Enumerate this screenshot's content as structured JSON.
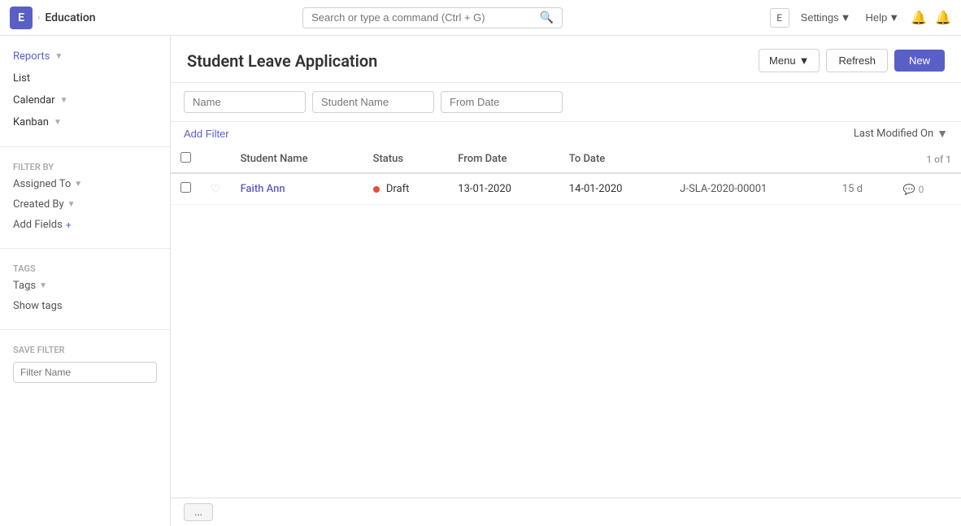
{
  "app": {
    "icon_letter": "E",
    "breadcrumb_separator": "›",
    "app_name": "Education"
  },
  "navbar": {
    "search_placeholder": "Search or type a command (Ctrl + G)",
    "e_label": "E",
    "settings_label": "Settings",
    "help_label": "Help"
  },
  "page": {
    "title": "Student Leave Application",
    "menu_label": "Menu",
    "refresh_label": "Refresh",
    "new_label": "New"
  },
  "sidebar": {
    "reports_label": "Reports",
    "list_label": "List",
    "calendar_label": "Calendar",
    "kanban_label": "Kanban",
    "filter_by_label": "FILTER BY",
    "assigned_to_label": "Assigned To",
    "created_by_label": "Created By",
    "add_fields_label": "Add Fields",
    "tags_section_label": "TAGS",
    "tags_label": "Tags",
    "show_tags_label": "Show tags",
    "save_filter_label": "SAVE FILTER",
    "filter_name_placeholder": "Filter Name"
  },
  "filters": {
    "name_placeholder": "Name",
    "student_name_placeholder": "Student Name",
    "from_date_placeholder": "From Date",
    "add_filter_label": "Add Filter",
    "last_modified_label": "Last Modified On"
  },
  "table": {
    "columns": [
      "Student Name",
      "Status",
      "From Date",
      "To Date",
      "",
      "",
      ""
    ],
    "count_label": "1 of 1",
    "rows": [
      {
        "student_name": "Faith Ann",
        "status": "Draft",
        "status_type": "draft",
        "from_date": "13-01-2020",
        "to_date": "14-01-2020",
        "doc_id": "J-SLA-2020-00001",
        "duration": "15 d",
        "comments": "0"
      }
    ]
  },
  "bottom": {
    "button_label": "..."
  }
}
